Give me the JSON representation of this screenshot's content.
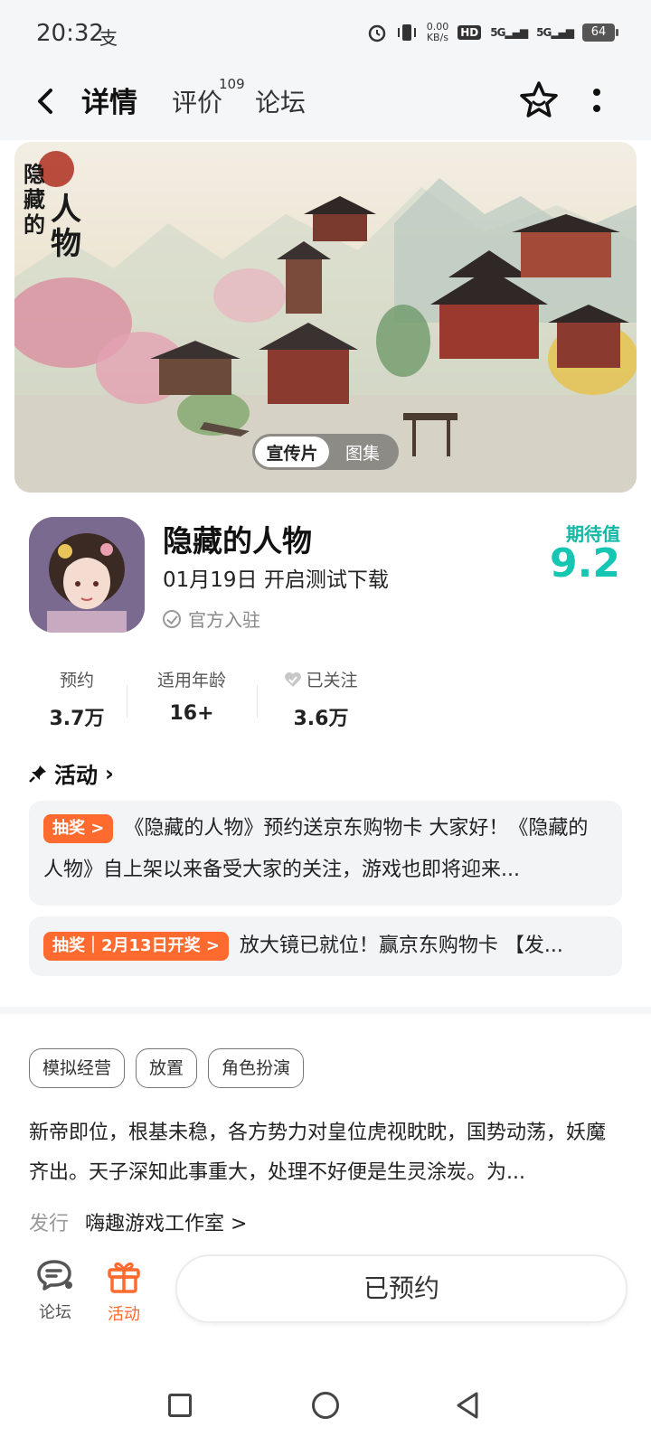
{
  "status_bar": {
    "time": "20:32",
    "pay_icon_text": "支",
    "net_speed_value": "0.00",
    "net_speed_unit": "KB/s",
    "hd_label": "HD",
    "signal1": "5G",
    "signal2": "5G",
    "battery": "64"
  },
  "header": {
    "tabs": [
      {
        "label": "详情",
        "active": true
      },
      {
        "label": "评价",
        "count": "109"
      },
      {
        "label": "论坛"
      }
    ]
  },
  "banner": {
    "logo_text_vertical": "隐藏的",
    "logo_text_big": "人物",
    "media_tabs": [
      {
        "label": "宣传片",
        "active": true
      },
      {
        "label": "图集",
        "active": false
      }
    ]
  },
  "game": {
    "title": "隐藏的人物",
    "subtitle": "01月19日 开启测试下载",
    "official": "官方入驻",
    "expect_label": "期待值",
    "expect_value": "9.2"
  },
  "stats": [
    {
      "label": "预约",
      "value": "3.7万"
    },
    {
      "label": "适用年龄",
      "value": "16+"
    },
    {
      "label": "已关注",
      "value": "3.6万"
    }
  ],
  "activity": {
    "heading": "活动",
    "cards": [
      {
        "badge": "抽奖 >",
        "text": "《隐藏的人物》预约送京东购物卡 大家好！《隐藏的人物》自上架以来备受大家的关注，游戏也即将迎来..."
      },
      {
        "badge": "抽奖｜2月13日开奖 >",
        "text": "放大镜已就位！赢京东购物卡 【发..."
      }
    ]
  },
  "tags": [
    "模拟经营",
    "放置",
    "角色扮演"
  ],
  "description": "新帝即位，根基未稳，各方势力对皇位虎视眈眈，国势动荡，妖魔齐出。天子深知此事重大，处理不好便是生灵涂炭。为...",
  "publisher": {
    "label": "发行",
    "name": "嗨趣游戏工作室 >"
  },
  "bottom_bar": {
    "forum_label": "论坛",
    "activity_label": "活动",
    "reserve_label": "已预约"
  },
  "colors": {
    "accent_teal": "#15c6b3",
    "accent_orange": "#ff6a2f"
  }
}
